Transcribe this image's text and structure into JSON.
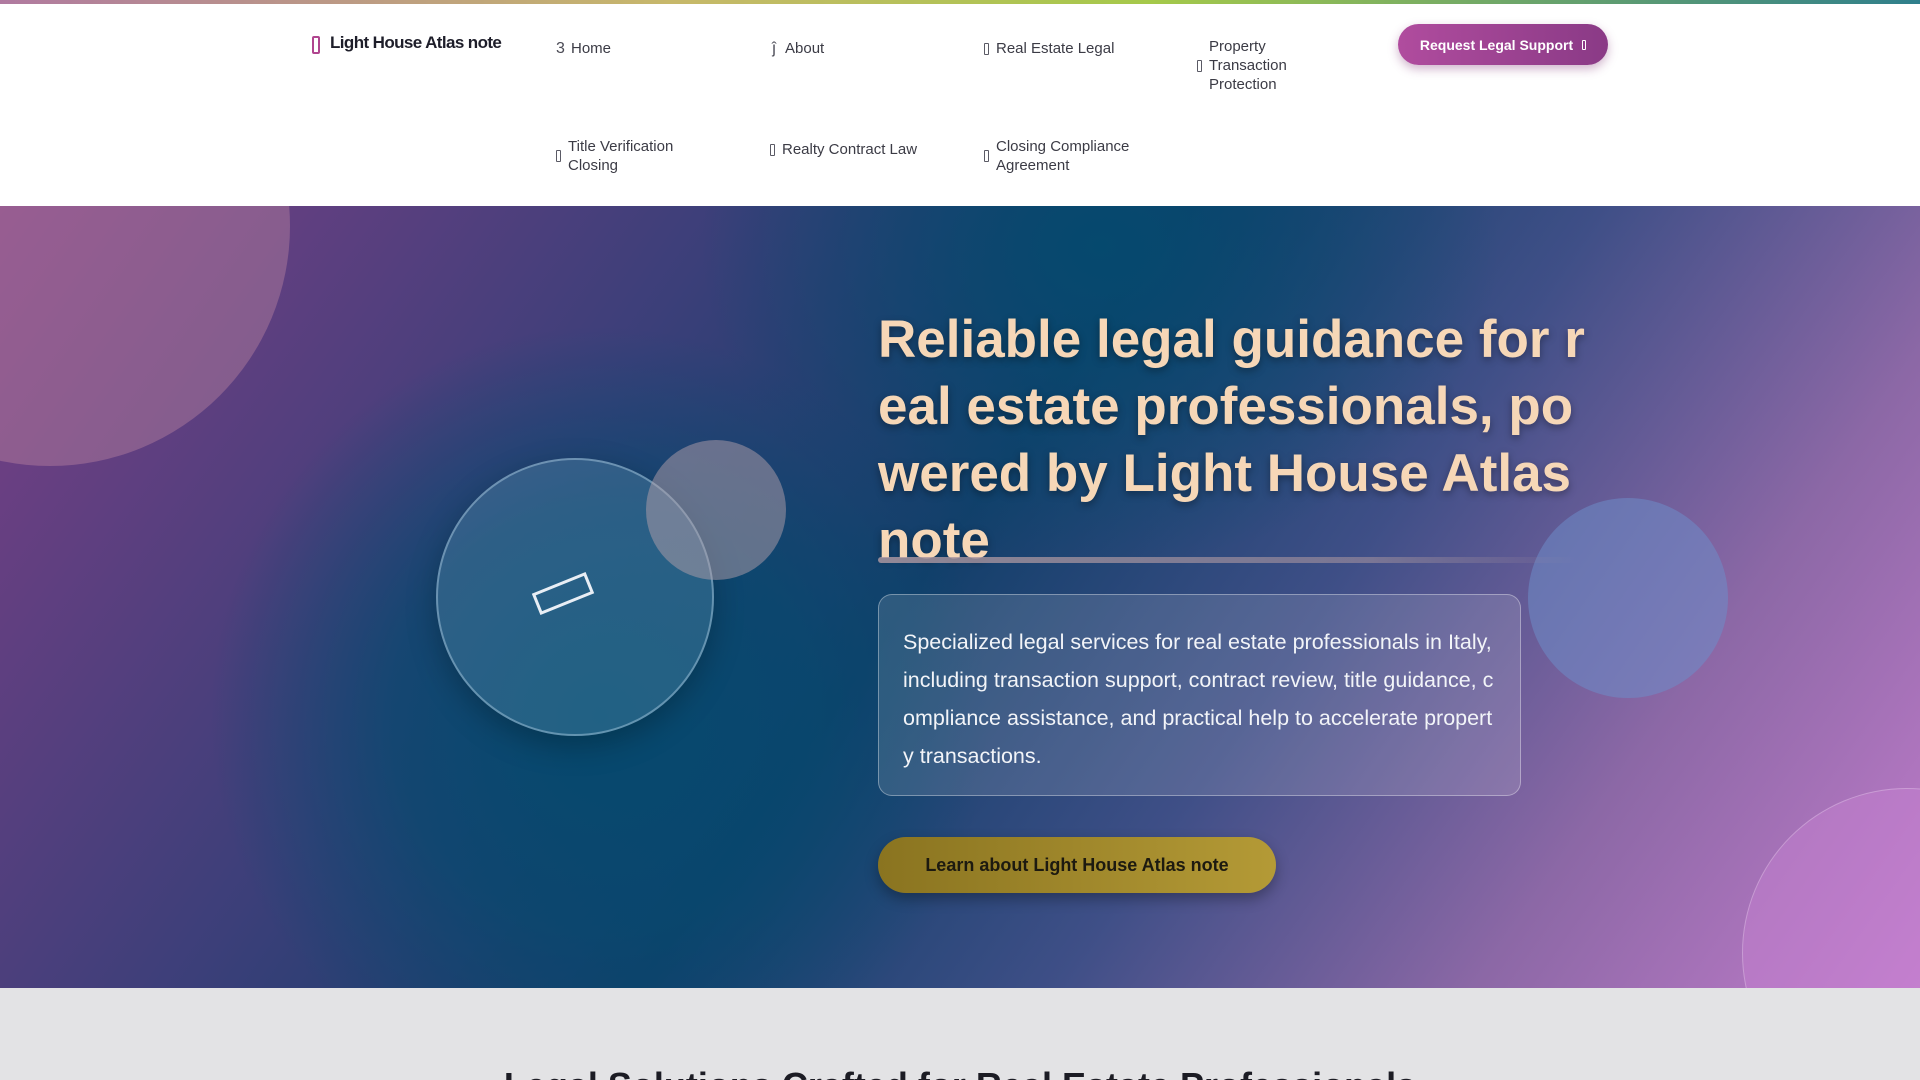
{
  "brand": {
    "name": "Light House Atlas note"
  },
  "nav": {
    "items": [
      {
        "label": "Home",
        "icon": "home-icon",
        "glyph": "3"
      },
      {
        "label": "About",
        "icon": "info-icon",
        "glyph": "ĵ"
      },
      {
        "label": "Real Estate Legal",
        "icon": "building-icon"
      },
      {
        "label": "Property\nTransaction\nProtection",
        "icon": "shield-icon"
      },
      {
        "label": "Title Verification\nClosing",
        "icon": "document-icon"
      },
      {
        "label": "Realty Contract Law",
        "icon": "contract-icon"
      },
      {
        "label": "Closing Compliance\nAgreement",
        "icon": "check-icon"
      }
    ],
    "cta_label": "Request Legal Support"
  },
  "hero": {
    "title": "Reliable legal guidance for real estate professionals, powered by Light House Atlas note",
    "description": "Specialized legal services for real estate professionals in Italy, including transaction support, contract review, title guidance, compliance assistance, and practical help to accelerate property transactions.",
    "button_label": "Learn about Light House Atlas note"
  },
  "section2": {
    "title": "Legal Solutions Crafted for Real Estate Professionals"
  },
  "colors": {
    "accent": "#b04c9e",
    "title": "#f6d7b7",
    "hero_button": "#b49a36",
    "hero_dark": "#05496e"
  }
}
